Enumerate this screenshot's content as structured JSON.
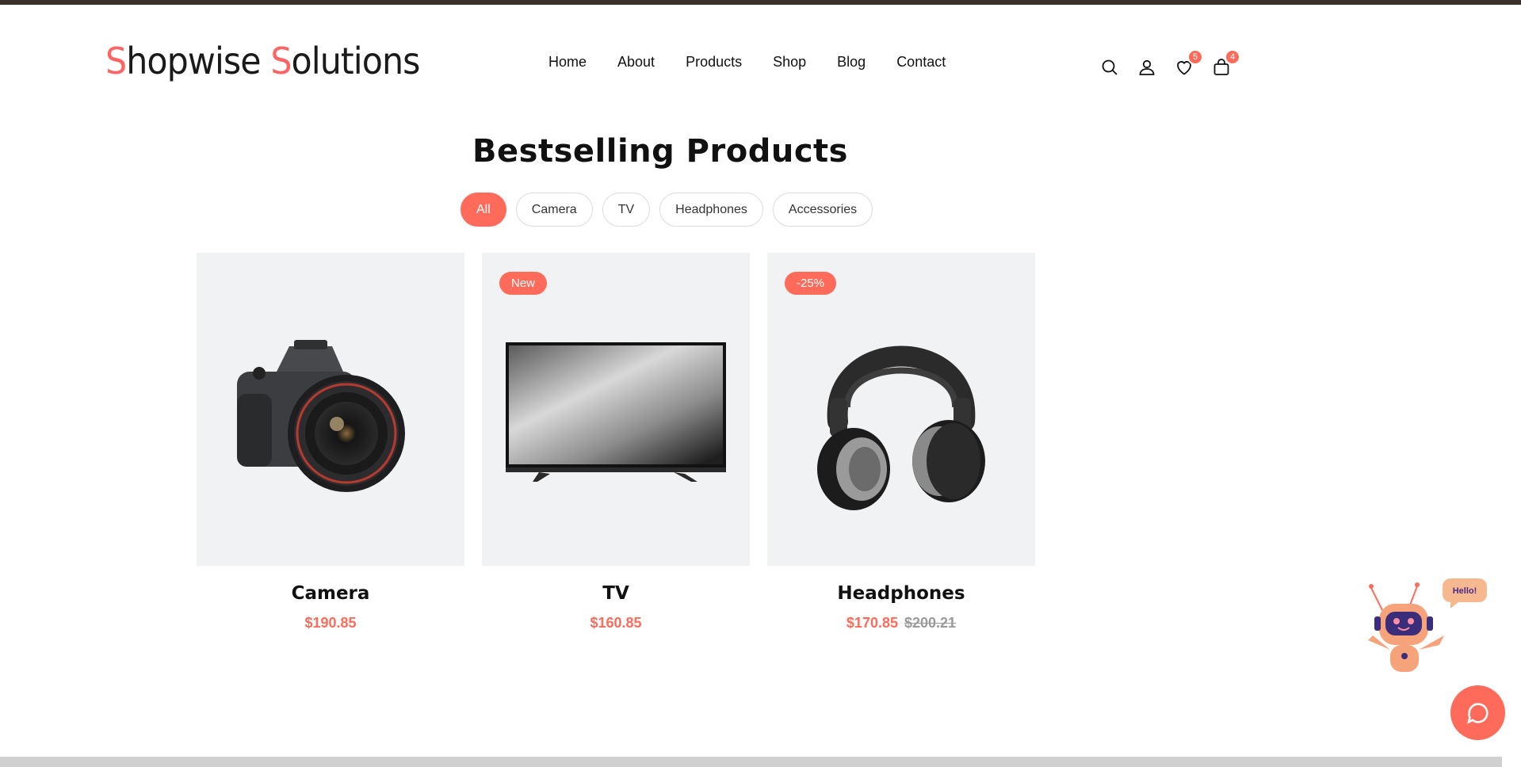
{
  "header": {
    "logo": {
      "first": "hopwise ",
      "first_initial": "S",
      "second_initial": "S",
      "second": "olutions"
    },
    "nav": [
      "Home",
      "About",
      "Products",
      "Shop",
      "Blog",
      "Contact"
    ],
    "icons": {
      "search": "search-icon",
      "user": "user-icon",
      "wishlist": "heart-icon",
      "cart": "bag-icon"
    },
    "wishlist_count": "5",
    "cart_count": "4"
  },
  "section": {
    "title": "Bestselling Products",
    "filters": [
      "All",
      "Camera",
      "TV",
      "Headphones",
      "Accessories"
    ],
    "active_filter": "All"
  },
  "products": [
    {
      "name": "Camera",
      "price": "$190.85",
      "old_price": "",
      "tag": ""
    },
    {
      "name": "TV",
      "price": "$160.85",
      "old_price": "",
      "tag": "New"
    },
    {
      "name": "Headphones",
      "price": "$170.85",
      "old_price": "$200.21",
      "tag": "-25%"
    }
  ],
  "chat": {
    "bubble_text": "Hello!"
  },
  "colors": {
    "accent": "#ff6b5b",
    "card_bg": "#f1f2f4",
    "top_strip": "#3a302c"
  }
}
